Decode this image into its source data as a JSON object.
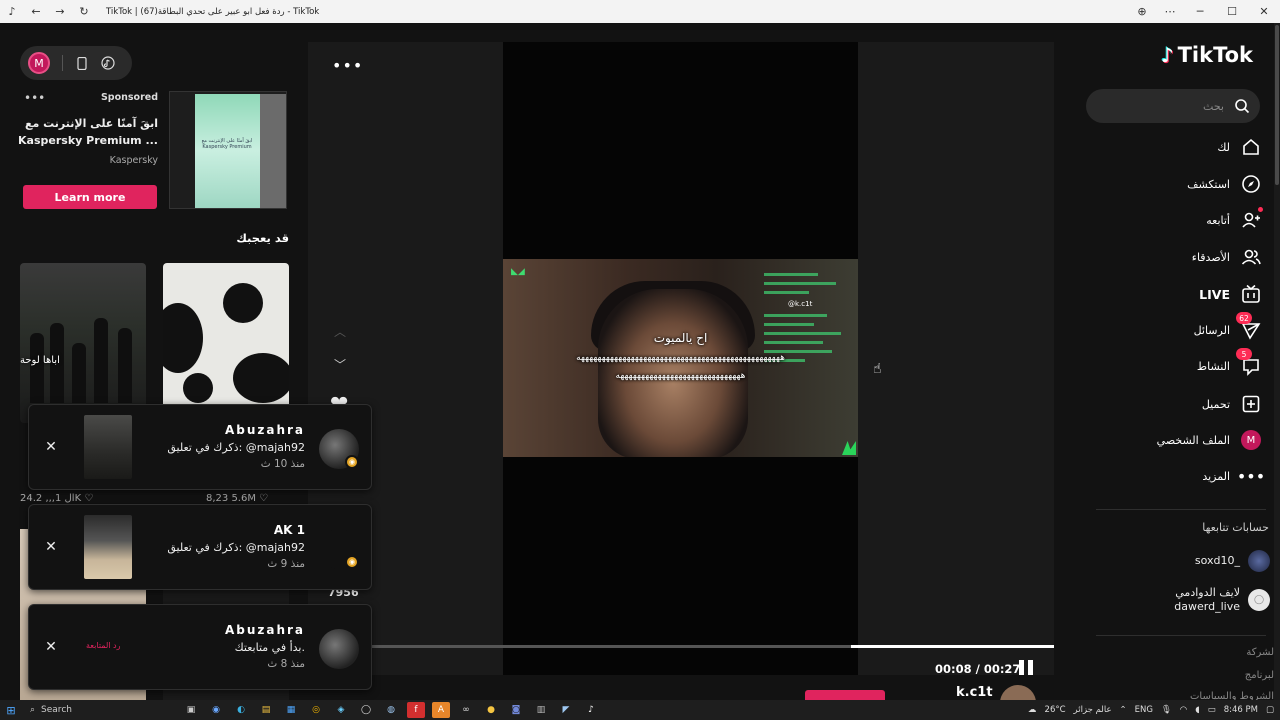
{
  "window": {
    "title": "TikTok | ردة فعل ابو عبير على تحدي البطاقة(67) - TikTok",
    "controls": {
      "zoom": "⊕",
      "more": "⋯",
      "minimize": "─",
      "maximize": "☐",
      "close": "✕"
    }
  },
  "left_panel": {
    "profile_initial": "M",
    "ad": {
      "sponsored_label": "Sponsored",
      "headline": "ابقَ آمنًا على الإنترنت مع Kaspersky Premium ...",
      "brand": "Kaspersky",
      "cta_label": "Learn more",
      "thumb_text": "ابقَ آمنًا على الإنترنت مع Kaspersky Premium"
    },
    "suggested_title": "قد يعجبك",
    "card1_caption": "اباها لوحة",
    "stats_left": "ال   1,,,        24.2K ♡",
    "stats_right": "8,23   5.6M ♡"
  },
  "notifications": [
    {
      "name": "Abuzahra",
      "message": "ذكرك في تعليق: @majah92",
      "time": "منذ 10 ث"
    },
    {
      "name": "AK 1",
      "message": "ذكرك في تعليق: @majah92",
      "time": "منذ 9 ث"
    },
    {
      "name": "Abuzahra",
      "message": "بدأ في متابعتك.",
      "time": "منذ 8 ث",
      "thumb_text": "رد المتابعة"
    }
  ],
  "video": {
    "likes": "7956",
    "subtitle_1": "اح يالميوت",
    "subtitle_2": "هههههههههههههههههههههههههههههههههههههههههههههههههه",
    "subtitle_3": "ههههههههههههههههههههههههههههههه",
    "chat_handle": "@k.c1t",
    "current_time": "00:08",
    "total_time": "00:27",
    "time_display": "00:08 / 00:27",
    "progress_fraction": 0.2963,
    "author_partial": "k.c1t"
  },
  "sidebar": {
    "logo_text": "TikTok",
    "search_placeholder": "بحث",
    "nav": [
      {
        "label": "لك"
      },
      {
        "label": "استكشف"
      },
      {
        "label": "أتابعه"
      },
      {
        "label": "الأصدقاء"
      },
      {
        "label": "LIVE"
      },
      {
        "label": "الرسائل",
        "badge": "62"
      },
      {
        "label": "النشاط",
        "badge": "5"
      },
      {
        "label": "تحميل"
      },
      {
        "label": "الملف الشخصي",
        "avatar": "M"
      },
      {
        "label": "المزيد"
      }
    ],
    "following_title": "حسابات تتابعها",
    "following": [
      {
        "name": "soxd10_"
      },
      {
        "name_line1": "لايف الدوادمي",
        "name_line2": "dawerd_live"
      }
    ],
    "footer": [
      "لشركة",
      "لبرنامج",
      "الشروط والسياسات"
    ]
  },
  "taskbar": {
    "search_label": "Search",
    "weather": "26°C",
    "news": "عالم جزائر",
    "lang": "ENG",
    "time": "8:46 PM"
  },
  "colors": {
    "accent": "#fe2c55",
    "cta": "#e0245e",
    "background": "#121212"
  }
}
